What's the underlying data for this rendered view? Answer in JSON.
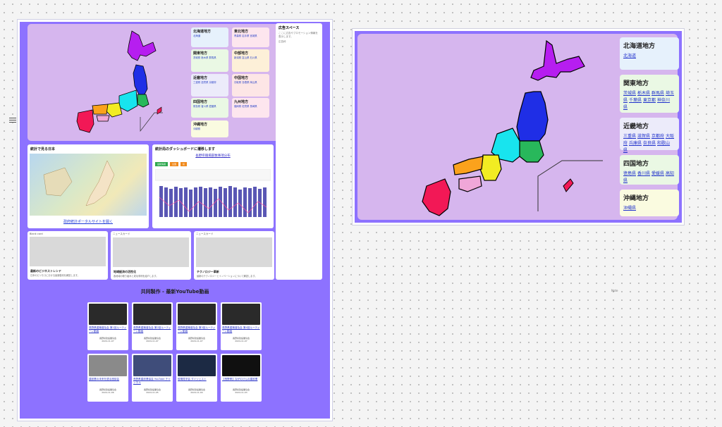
{
  "right_map": {
    "regions": [
      {
        "title": "北海道地方",
        "links": [
          "北海道"
        ],
        "color": "#e6f1fc"
      },
      {
        "title": "関東地方",
        "links": [
          "茨城県",
          "栃木県",
          "群馬県",
          "埼玉県",
          "千葉県",
          "東京都",
          "神奈川県"
        ],
        "color": "#eaf8e4"
      },
      {
        "title": "近畿地方",
        "links": [
          "三重県",
          "滋賀県",
          "京都府",
          "大阪府",
          "兵庫県",
          "奈良県",
          "和歌山県"
        ],
        "color": "#ecebfa"
      },
      {
        "title": "四国地方",
        "links": [
          "徳島県",
          "香川県",
          "愛媛県",
          "高知県"
        ],
        "color": "#eaf8e4"
      },
      {
        "title": "沖縄地方",
        "links": [
          "沖縄県"
        ],
        "color": "#fafbe0"
      }
    ]
  },
  "left_page": {
    "regions": [
      {
        "title": "北海道地方",
        "links": [
          "北海道"
        ],
        "color": "#e6f1fc"
      },
      {
        "title": "東北地方",
        "links": [
          "青森県",
          "岩手県",
          "宮城県",
          "秋田県",
          "山形県",
          "福島県"
        ],
        "color": "#fde6ee"
      },
      {
        "title": "関東地方",
        "links": [
          "茨城県",
          "栃木県",
          "群馬県",
          "埼玉県",
          "千葉県",
          "東京都",
          "神奈川県"
        ],
        "color": "#eaf8e4"
      },
      {
        "title": "中部地方",
        "links": [
          "新潟県",
          "富山県",
          "石川県",
          "福井県",
          "山梨県",
          "長野県",
          "岐阜県",
          "静岡県",
          "愛知県"
        ],
        "color": "#fdf0d8"
      },
      {
        "title": "近畿地方",
        "links": [
          "三重県",
          "滋賀県",
          "京都府",
          "大阪府",
          "兵庫県",
          "奈良県",
          "和歌山県"
        ],
        "color": "#ecebfa"
      },
      {
        "title": "中国地方",
        "links": [
          "鳥取県",
          "島根県",
          "岡山県",
          "広島県",
          "山口県"
        ],
        "color": "#fde6e6"
      },
      {
        "title": "四国地方",
        "links": [
          "徳島県",
          "香川県",
          "愛媛県",
          "高知県"
        ],
        "color": "#eaf8e4"
      },
      {
        "title": "九州地方",
        "links": [
          "福岡県",
          "佐賀県",
          "長崎県",
          "熊本県",
          "大分県",
          "宮崎県",
          "鹿児島県"
        ],
        "color": "#fde6ee"
      },
      {
        "title": "沖縄地方",
        "links": [
          "沖縄県"
        ],
        "color": "#fafbe0"
      }
    ],
    "ad": {
      "title": "広告スペース",
      "desc": "ここに広告やプロモーション情報を表示します。",
      "sub": "広告枠"
    },
    "stats_card": {
      "title": "統計で見る日本",
      "link": "政府統計ポータルサイトを開く"
    },
    "dashboard": {
      "title": "統計局のダッシュボードに遷移します",
      "link": "長野県職場部数事項分布",
      "tags": [
        "最新情報",
        "全国",
        "県"
      ]
    },
    "small_cards": [
      {
        "label": "Blank card",
        "title": "最新のビジネストレンド",
        "desc": "日本のビジネスにおける最新動向を解説します。"
      },
      {
        "label": "ニュースカード",
        "title": "地域経済の活性化",
        "desc": "各地域の取り組みと成功事例を紹介します。"
      },
      {
        "label": "ニュースカード",
        "title": "テクノロジー革新",
        "desc": "最新のテクノロジーとイノベーションについて解説します。"
      }
    ],
    "youtube_heading": "共同製作 - 最新YouTube動画",
    "videos": [
      {
        "title": "長野県建築普及会 第1回ルーティーン動画",
        "channel": "長野県建設業協会",
        "date": "2024-11-07"
      },
      {
        "title": "長野県建築普及会 第2回ルーティーン動画",
        "channel": "長野県建設業協会",
        "date": "2024-11-07"
      },
      {
        "title": "長野県建築普及会 第3回ルーティーン動画",
        "channel": "長野県建設業協会",
        "date": "2024-11-07"
      },
      {
        "title": "長野県建築普及会 第4回ルーティーン動画",
        "channel": "長野県建設業協会",
        "date": "2024-11-07"
      },
      {
        "title": "建設業の未来を語る座談会",
        "channel": "長野県建設業協会",
        "date": "2024-11-06"
      },
      {
        "title": "長野県建設業協会 YouTube チャンネル",
        "channel": "長野県建設業協会",
        "date": "2024-11-05"
      },
      {
        "title": "現場見学会 ダイジェスト",
        "channel": "長野県建設業協会",
        "date": "2024-11-04"
      },
      {
        "title": "【長野県】ながのけんの建設業",
        "channel": "長野県建設業協会",
        "date": "2024-11-03"
      }
    ]
  },
  "canvas_note": "Note"
}
